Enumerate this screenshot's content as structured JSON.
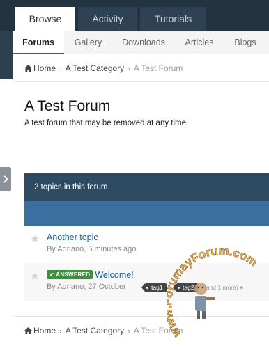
{
  "main_tabs": [
    {
      "label": "Browse",
      "active": true
    },
    {
      "label": "Activity",
      "active": false
    },
    {
      "label": "Tutorials",
      "active": false
    }
  ],
  "sub_nav": [
    {
      "label": "Forums",
      "active": true
    },
    {
      "label": "Gallery",
      "active": false
    },
    {
      "label": "Downloads",
      "active": false
    },
    {
      "label": "Articles",
      "active": false
    },
    {
      "label": "Blogs",
      "active": false
    }
  ],
  "breadcrumb": {
    "home": "Home",
    "category": "A Test Category",
    "current": "A Test Forum"
  },
  "forum": {
    "title": "A Test Forum",
    "description": "A test forum that may be removed at any time."
  },
  "topics": {
    "count_label": "2 topics in this forum",
    "items": [
      {
        "title": "Another topic",
        "meta": "By Adriano, 5 minutes ago"
      },
      {
        "badge": "ANSWERED",
        "title": "Welcome!",
        "meta": "By Adriano, 27 October",
        "tags": [
          "tag1",
          "tag2"
        ],
        "more_tags": "(and 1 more)"
      }
    ]
  },
  "icons": {
    "home": "home-icon",
    "star": "star-icon",
    "check": "check-icon",
    "chevron": "chevron-right-icon",
    "caret": "caret-down-icon"
  },
  "colors": {
    "topbar": "#233340",
    "topics_header": "#2f4b63",
    "topics_bar": "#3b6fa0",
    "link": "#1e5d9b",
    "answered_badge": "#3e8f3e"
  },
  "watermark_text": "www.ForumayForum.com"
}
